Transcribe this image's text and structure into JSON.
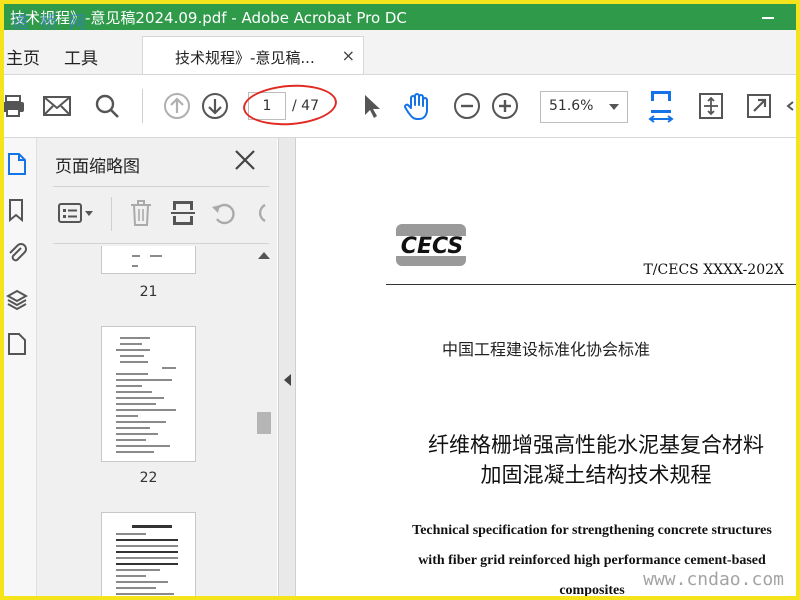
{
  "window": {
    "title": "技术规程》-意见稿2024.09.pdf - Adobe Acrobat Pro DC"
  },
  "watermark": {
    "logo_text": "道 桥 网",
    "bottom_text": "www.cndao.com"
  },
  "tabs": {
    "home": "主页",
    "tools": "工具",
    "document": "技术规程》-意见稿...",
    "close": "×"
  },
  "toolbar": {
    "page_current": "1",
    "page_total": "/ 47",
    "zoom": "51.6%"
  },
  "thumbnails_panel": {
    "title": "页面缩略图",
    "pages": [
      {
        "label": "21"
      },
      {
        "label": "22"
      }
    ]
  },
  "document": {
    "logo": "CECS",
    "code": "T/CECS XXXX-202X",
    "association": "中国工程建设标准化协会标准",
    "title_cn_line1": "纤维格栅增强高性能水泥基复合材料",
    "title_cn_line2": "加固混凝土结构技术规程",
    "title_en_line1": "Technical specification for strengthening concrete structures",
    "title_en_line2": "with fiber grid reinforced high performance cement-based",
    "title_en_line3": "composites"
  },
  "colors": {
    "titlebar": "#2e9a4a",
    "border": "#f5e31c",
    "accent": "#1473e6",
    "annotation": "#e02a22"
  }
}
